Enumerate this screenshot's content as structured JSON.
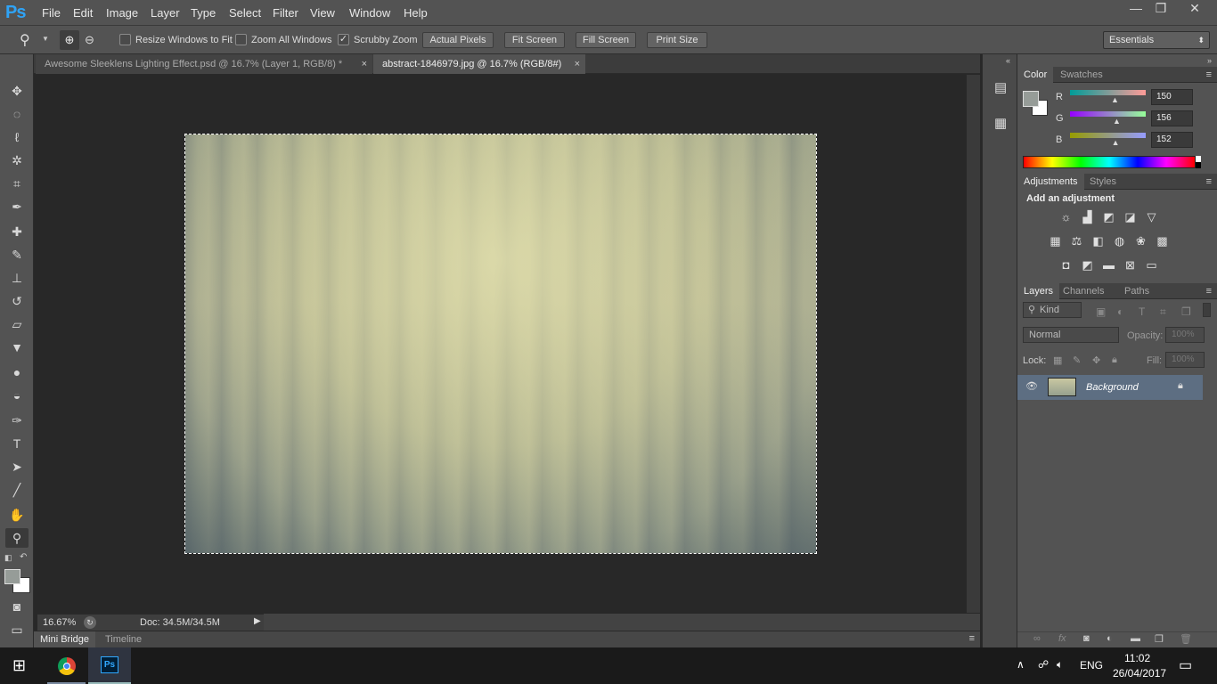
{
  "app": {
    "logo": "Ps"
  },
  "menu": [
    "File",
    "Edit",
    "Image",
    "Layer",
    "Type",
    "Select",
    "Filter",
    "View",
    "Window",
    "Help"
  ],
  "window_controls": {
    "minimize": "—",
    "restore": "❐",
    "close": "✕"
  },
  "options": {
    "resize_windows": "Resize Windows to Fit",
    "zoom_all": "Zoom All Windows",
    "scrubby_zoom": "Scrubby Zoom",
    "buttons": [
      "Actual Pixels",
      "Fit Screen",
      "Fill Screen",
      "Print Size"
    ],
    "workspace": "Essentials"
  },
  "tabs": [
    {
      "label": "Awesome Sleeklens Lighting Effect.psd @ 16.7% (Layer 1, RGB/8) *",
      "close": "×"
    },
    {
      "label": "abstract-1846979.jpg @ 16.7% (RGB/8#)",
      "close": "×"
    }
  ],
  "status": {
    "zoom": "16.67%",
    "doc": "Doc: 34.5M/34.5M"
  },
  "bottom_tabs": [
    "Mini Bridge",
    "Timeline"
  ],
  "color_panel": {
    "tabs": [
      "Color",
      "Swatches"
    ],
    "channels": [
      {
        "label": "R",
        "value": "150",
        "fraction": 0.588
      },
      {
        "label": "G",
        "value": "156",
        "fraction": 0.612
      },
      {
        "label": "B",
        "value": "152",
        "fraction": 0.596
      }
    ],
    "foreground": "#969c98",
    "background": "#ffffff"
  },
  "adjustments_panel": {
    "tabs": [
      "Adjustments",
      "Styles"
    ],
    "heading": "Add an adjustment"
  },
  "layers_panel": {
    "tabs": [
      "Layers",
      "Channels",
      "Paths"
    ],
    "filter_kind": "Kind",
    "blend_mode": "Normal",
    "opacity_label": "Opacity:",
    "opacity_value": "100%",
    "lock_label": "Lock:",
    "fill_label": "Fill:",
    "fill_value": "100%",
    "layers": [
      {
        "name": "Background",
        "visible": true,
        "locked": true
      }
    ]
  },
  "taskbar": {
    "lang": "ENG",
    "time": "11:02",
    "date": "26/04/2017"
  },
  "colors": {
    "accent": "#2fa3f6",
    "layer_selected": "#5d6e82"
  }
}
